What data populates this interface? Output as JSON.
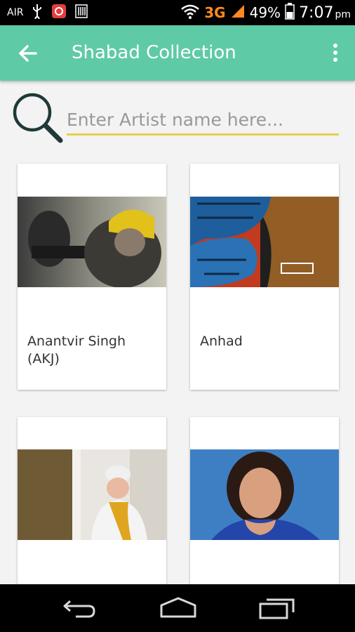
{
  "status_bar": {
    "carrier": "AIR",
    "network": "3G",
    "battery": "49%",
    "time": "7:07",
    "ampm": "pm"
  },
  "app_bar": {
    "title": "Shabad Collection"
  },
  "search": {
    "placeholder": "Enter Artist name here..."
  },
  "artists": [
    {
      "name_line1": "Anantvir Singh",
      "name_line2": "(AKJ)"
    },
    {
      "name_line1": "Anhad",
      "name_line2": ""
    },
    {
      "name_line1": "",
      "name_line2": ""
    },
    {
      "name_line1": "",
      "name_line2": ""
    }
  ],
  "colors": {
    "app_bar": "#5fcaa6",
    "search_underline": "#e5cf4a",
    "network_accent": "#ff8a1f"
  },
  "icons": [
    "back-arrow-icon",
    "overflow-menu-icon",
    "search-icon",
    "nav-back-icon",
    "nav-home-icon",
    "nav-recents-icon"
  ]
}
